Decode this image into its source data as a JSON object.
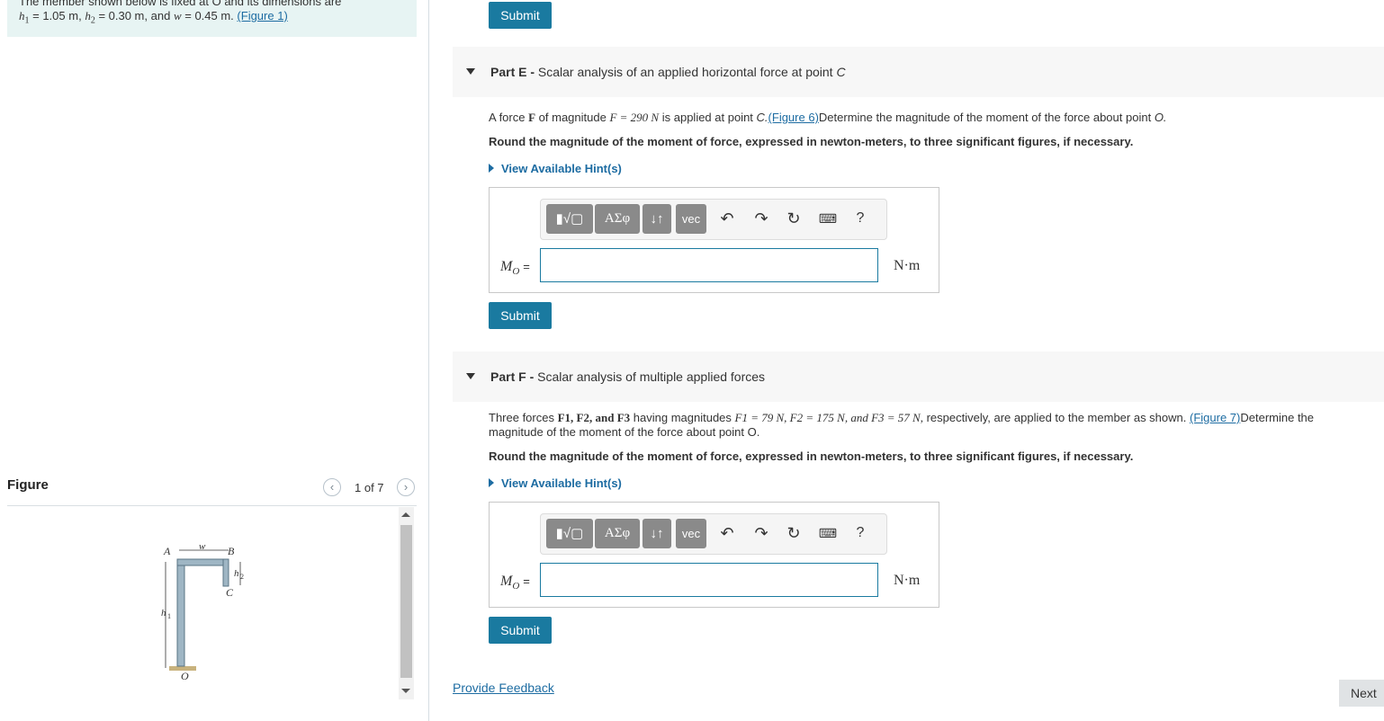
{
  "intro": {
    "line1": "The member shown below is fixed at O and its dimensions are",
    "h1_label": "h",
    "h1_sub": "1",
    "h1_val": "= 1.05 m",
    "h2_label": "h",
    "h2_sub": "2",
    "h2_val": "= 0.30 m",
    "and": ", and",
    "w_label": "w",
    "w_val": "= 0.45 m.",
    "figure_link": "(Figure 1)"
  },
  "figure_panel": {
    "title": "Figure",
    "counter": "1 of 7",
    "prev_icon": "chevron-left-icon",
    "next_icon": "chevron-right-icon",
    "diagram_labels": {
      "A": "A",
      "B": "B",
      "C": "C",
      "O": "O",
      "w": "w",
      "h1": "h",
      "h1_sub": "1",
      "h2": "h",
      "h2_sub": "2"
    }
  },
  "top_submit": "Submit",
  "partE": {
    "prefix": "Part E -",
    "title": "Scalar analysis of an applied horizontal force at point",
    "title_point": "C",
    "q_a": "A force",
    "q_F": "F",
    "q_b": "of magnitude",
    "q_eq": "F = 290 N",
    "q_c": "is applied at point",
    "q_point": "C.",
    "q_link": "(Figure 6)",
    "q_d": "Determine the magnitude of the moment of the force about point",
    "q_O": "O.",
    "round": "Round the magnitude of the moment of force, expressed in newton-meters, to three significant figures, if necessary.",
    "hint": "View Available Hint(s)",
    "label": "M",
    "label_sub": "O",
    "label_eq": "=",
    "input_value": "",
    "unit": "N·m",
    "submit": "Submit"
  },
  "partF": {
    "prefix": "Part F -",
    "title": "Scalar analysis of multiple applied forces",
    "q_a": "Three forces",
    "q_forces": "F1, F2, and F3",
    "q_b": "having magnitudes",
    "q_mags": "F1 = 79 N, F2 = 175 N, and F3 = 57 N,",
    "q_c": "respectively, are applied to the member as shown.",
    "q_link": "(Figure 7)",
    "q_d": "Determine the",
    "q_line2": "magnitude of the moment of the force about point O.",
    "round": "Round the magnitude of the moment of force, expressed in newton-meters, to three significant figures, if necessary.",
    "hint": "View Available Hint(s)",
    "label": "M",
    "label_sub": "O",
    "label_eq": "=",
    "input_value": "",
    "unit": "N·m",
    "submit": "Submit"
  },
  "toolbar": {
    "templates_icon": "templates-icon",
    "greek": "ΑΣφ",
    "arrows": "↓↑",
    "vec": "vec",
    "undo_icon": "undo-icon",
    "redo_icon": "redo-icon",
    "reset_icon": "reset-icon",
    "keyboard_icon": "keyboard-icon",
    "help": "?"
  },
  "footer": {
    "feedback": "Provide Feedback",
    "next": "Next"
  }
}
